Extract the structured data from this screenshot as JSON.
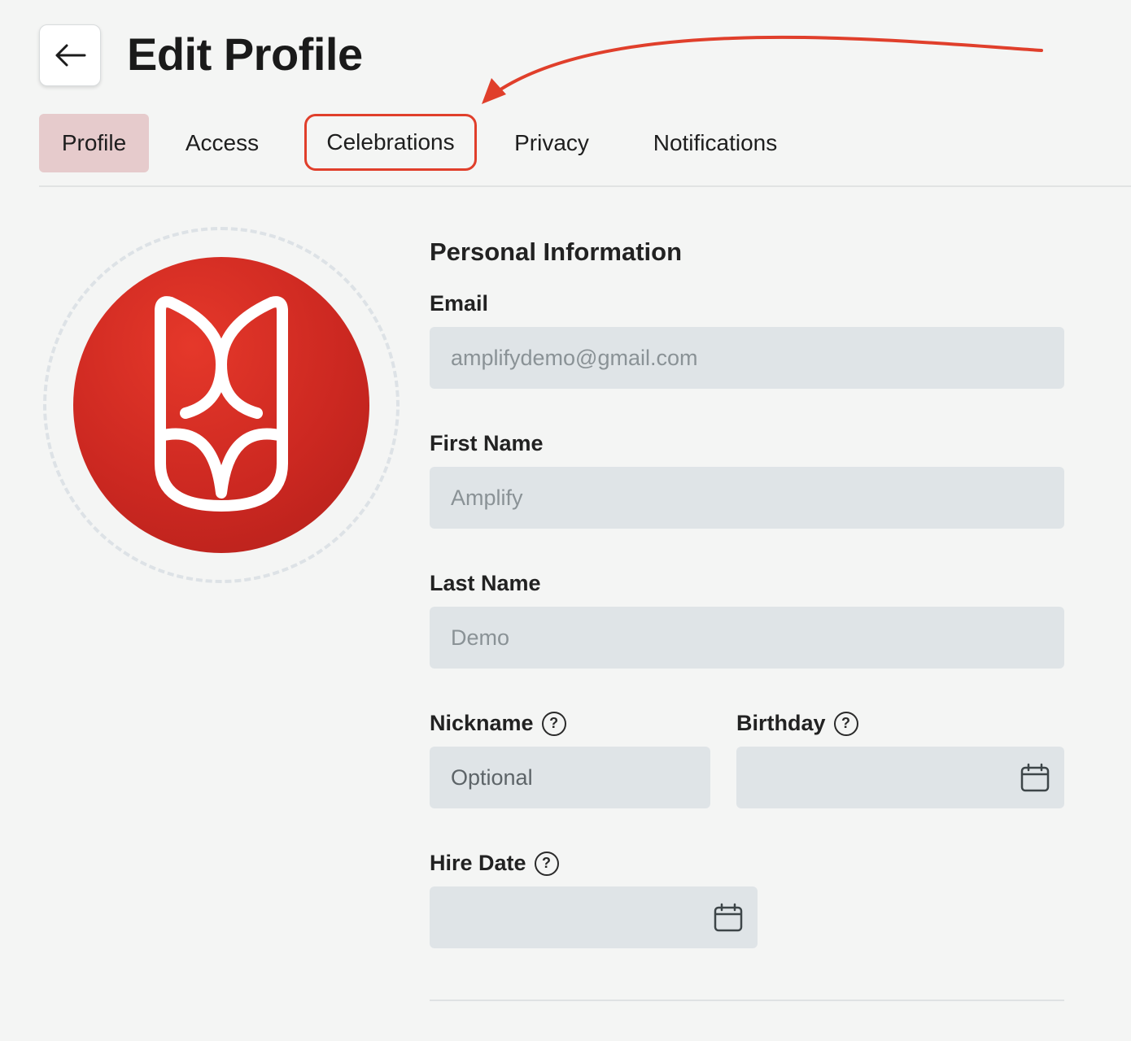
{
  "header": {
    "back_icon": "arrow-left-icon",
    "title": "Edit Profile"
  },
  "tabs": [
    {
      "label": "Profile",
      "active": true
    },
    {
      "label": "Access",
      "active": false
    },
    {
      "label": "Celebrations",
      "active": false,
      "highlighted": true
    },
    {
      "label": "Privacy",
      "active": false
    },
    {
      "label": "Notifications",
      "active": false
    }
  ],
  "colors": {
    "active_tab_bg": "#e6cbcc",
    "annotation": "#e03f2b",
    "avatar": "#cc2821",
    "input_bg": "#dfe4e7"
  },
  "avatar": {
    "icon": "amplify-logo-icon"
  },
  "form": {
    "section_title": "Personal Information",
    "email": {
      "label": "Email",
      "value": "amplifydemo@gmail.com"
    },
    "first_name": {
      "label": "First Name",
      "value": "Amplify"
    },
    "last_name": {
      "label": "Last Name",
      "value": "Demo"
    },
    "nickname": {
      "label": "Nickname",
      "placeholder": "Optional",
      "help_icon": "question-circle-icon"
    },
    "birthday": {
      "label": "Birthday",
      "value": "",
      "help_icon": "question-circle-icon",
      "icon": "calendar-icon"
    },
    "hire_date": {
      "label": "Hire Date",
      "value": "",
      "help_icon": "question-circle-icon",
      "icon": "calendar-icon"
    }
  }
}
